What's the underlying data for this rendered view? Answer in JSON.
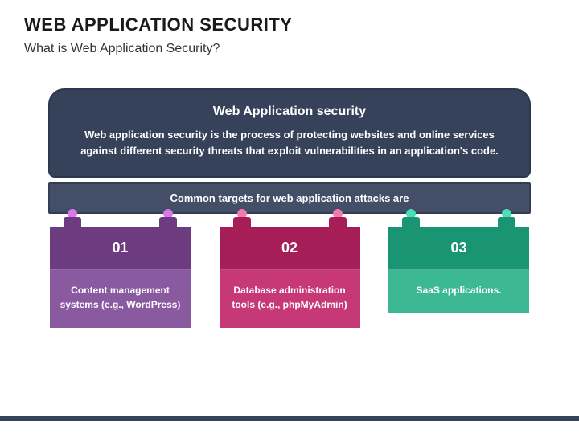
{
  "header": {
    "title": "WEB APPLICATION SECURITY",
    "subtitle": "What is Web Application Security?"
  },
  "top_box": {
    "title": "Web Application security",
    "desc": "Web application security is the process of protecting websites and online services against different security threats that exploit vulnerabilities in an application's code."
  },
  "mid_bar": "Common targets for web application attacks are",
  "cards": [
    {
      "num": "01",
      "text": "Content management systems (e.g., WordPress)"
    },
    {
      "num": "02",
      "text": "Database administration tools (e.g., phpMyAdmin)"
    },
    {
      "num": "03",
      "text": "SaaS applications."
    }
  ]
}
